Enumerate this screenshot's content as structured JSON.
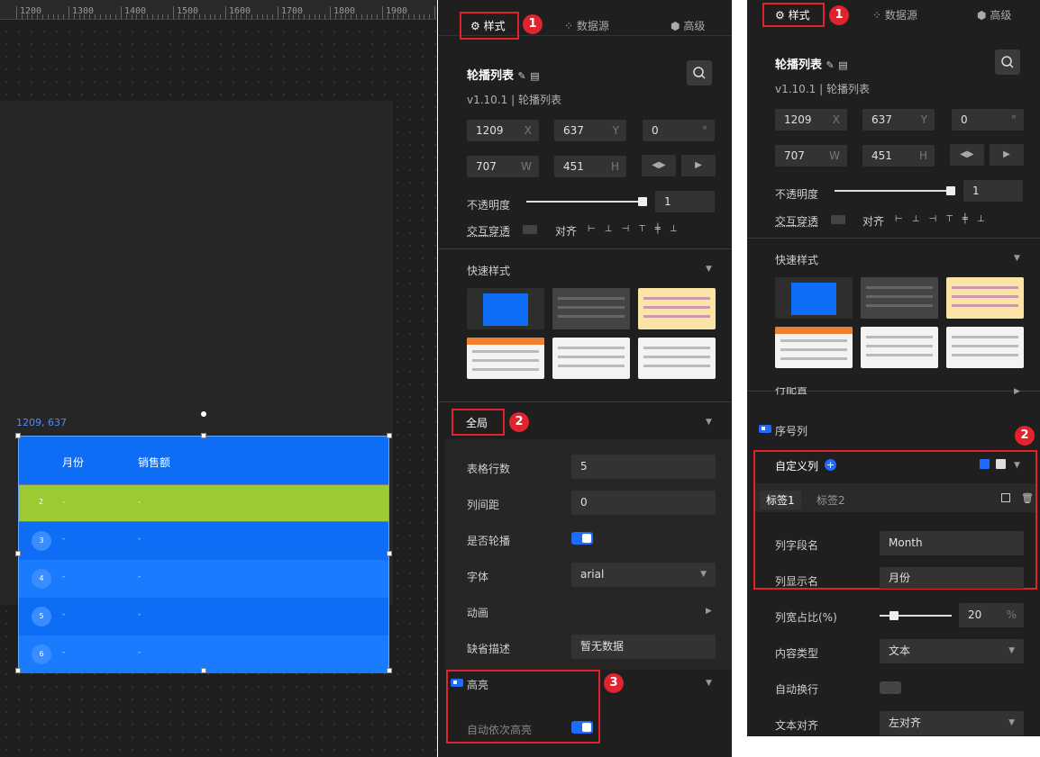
{
  "ruler": {
    "ticks": [
      "1200",
      "1300",
      "1400",
      "1500",
      "1600",
      "1700",
      "1800",
      "1900"
    ]
  },
  "canvas": {
    "coord": "1209, 637",
    "widget": {
      "headers": [
        "月份",
        "销售额"
      ],
      "rows": [
        {
          "idx": "2",
          "c1": "-",
          "c2": "-"
        },
        {
          "idx": "3",
          "c1": "-",
          "c2": "-"
        },
        {
          "idx": "4",
          "c1": "-",
          "c2": "-"
        },
        {
          "idx": "5",
          "c1": "-",
          "c2": "-"
        },
        {
          "idx": "6",
          "c1": "-",
          "c2": "-"
        }
      ],
      "colors": {
        "header": "#0d6df5",
        "highlight": "#9bcb30",
        "row_a": "#0d6df5",
        "row_b": "#1b7bff"
      }
    }
  },
  "panel_left": {
    "tabs": {
      "style": "样式",
      "datasource": "数据源",
      "advanced": "高级"
    },
    "badges": [
      "1",
      "2",
      "3"
    ],
    "component": {
      "name": "轮播列表",
      "version": "v1.10.1 | 轮播列表"
    },
    "pos": {
      "x": "1209",
      "x_s": "X",
      "y": "637",
      "y_s": "Y",
      "r": "0",
      "r_s": "°",
      "w": "707",
      "w_s": "W",
      "h": "451",
      "h_s": "H"
    },
    "opacity": {
      "label": "不透明度",
      "value": "1"
    },
    "interaction": {
      "label": "交互穿透",
      "align_label": "对齐"
    },
    "quick_style": "快速样式",
    "global": {
      "title": "全局",
      "rows_label": "表格行数",
      "rows_value": "5",
      "colgap_label": "列间距",
      "colgap_value": "0",
      "carousel_label": "是否轮播",
      "font_label": "字体",
      "font_value": "arial",
      "anim_label": "动画",
      "default_label": "缺省描述",
      "default_value": "暂无数据"
    },
    "highlight": {
      "title": "高亮",
      "auto_label": "自动依次高亮"
    }
  },
  "panel_right": {
    "tabs": {
      "style": "样式",
      "datasource": "数据源",
      "advanced": "高级"
    },
    "badges": [
      "1",
      "2"
    ],
    "component": {
      "name": "轮播列表",
      "version": "v1.10.1 | 轮播列表"
    },
    "pos": {
      "x": "1209",
      "x_s": "X",
      "y": "637",
      "y_s": "Y",
      "r": "0",
      "r_s": "°",
      "w": "707",
      "w_s": "W",
      "h": "451",
      "h_s": "H"
    },
    "opacity": {
      "label": "不透明度",
      "value": "1"
    },
    "interaction": {
      "label": "交互穿透",
      "align_label": "对齐"
    },
    "quick_style": "快速样式",
    "row_config": "行配置",
    "serial": "序号列",
    "custom": {
      "title": "自定义列",
      "tag1": "标签1",
      "tag2": "标签2",
      "field_label": "列字段名",
      "field_value": "Month",
      "display_label": "列显示名",
      "display_value": "月份"
    },
    "width_ratio": {
      "label": "列宽占比(%)",
      "value": "20",
      "suffix": "%"
    },
    "content_type": {
      "label": "内容类型",
      "value": "文本"
    },
    "wrap": {
      "label": "自动换行"
    },
    "text_align": {
      "label": "文本对齐",
      "value": "左对齐"
    }
  }
}
